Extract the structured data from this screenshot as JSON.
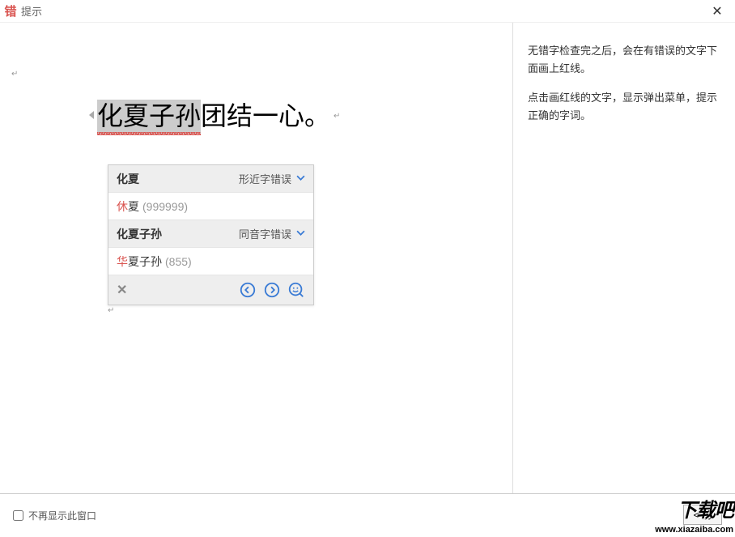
{
  "titlebar": {
    "app_icon": "错",
    "title": "提示",
    "close": "✕"
  },
  "document": {
    "sentence_highlighted": "化夏子孙",
    "sentence_rest": "团结一心。"
  },
  "popup": {
    "groups": [
      {
        "word": "化夏",
        "error_type": "形近字错误",
        "suggestion": {
          "correct_char": "休",
          "rest": "夏",
          "freq": "(999999)"
        }
      },
      {
        "word": "化夏子孙",
        "error_type": "同音字错误",
        "suggestion": {
          "correct_char": "华",
          "rest": "夏子孙",
          "freq": "(855)"
        }
      }
    ],
    "toolbar": {
      "close": "✕"
    }
  },
  "help": {
    "p1": "无错字检查完之后，会在有错误的文字下面画上红线。",
    "p2": "点击画红线的文字，显示弹出菜单，提示正确的字词。"
  },
  "footer": {
    "checkbox_label": "不再显示此窗口",
    "prev_btn": "< 前"
  },
  "watermark": {
    "text": "下载吧",
    "url": "www.xiazaiba.com"
  }
}
